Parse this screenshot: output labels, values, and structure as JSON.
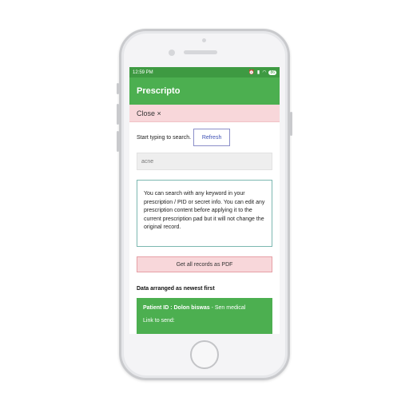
{
  "status_bar": {
    "time": "12:59 PM",
    "icons": [
      "alarm-icon",
      "signal-icon",
      "wifi-icon"
    ],
    "battery": "86"
  },
  "app": {
    "title": "Prescripto",
    "close_label": "Close ×"
  },
  "search": {
    "hint": "Start typing to search.",
    "refresh_label": "Refresh",
    "value": "acne"
  },
  "info_text": "You can search with any keyword in your prescription / PID or secret info. You can edit any prescription content before applying it to the current prescription pad but it will not change the original record.",
  "pdf_button_label": "Get all records as PDF",
  "section_title": "Data arranged as newest first",
  "record": {
    "patient_label": "Patient ID : Dolon biswas",
    "patient_suffix": " - Sen medical",
    "link_label": "Link to send:"
  },
  "colors": {
    "primary": "#4caf50",
    "status_bar": "#3e9a42",
    "close_bar": "#f8d7da",
    "refresh_text": "#3f51b5",
    "info_border": "#7cb8b0"
  }
}
